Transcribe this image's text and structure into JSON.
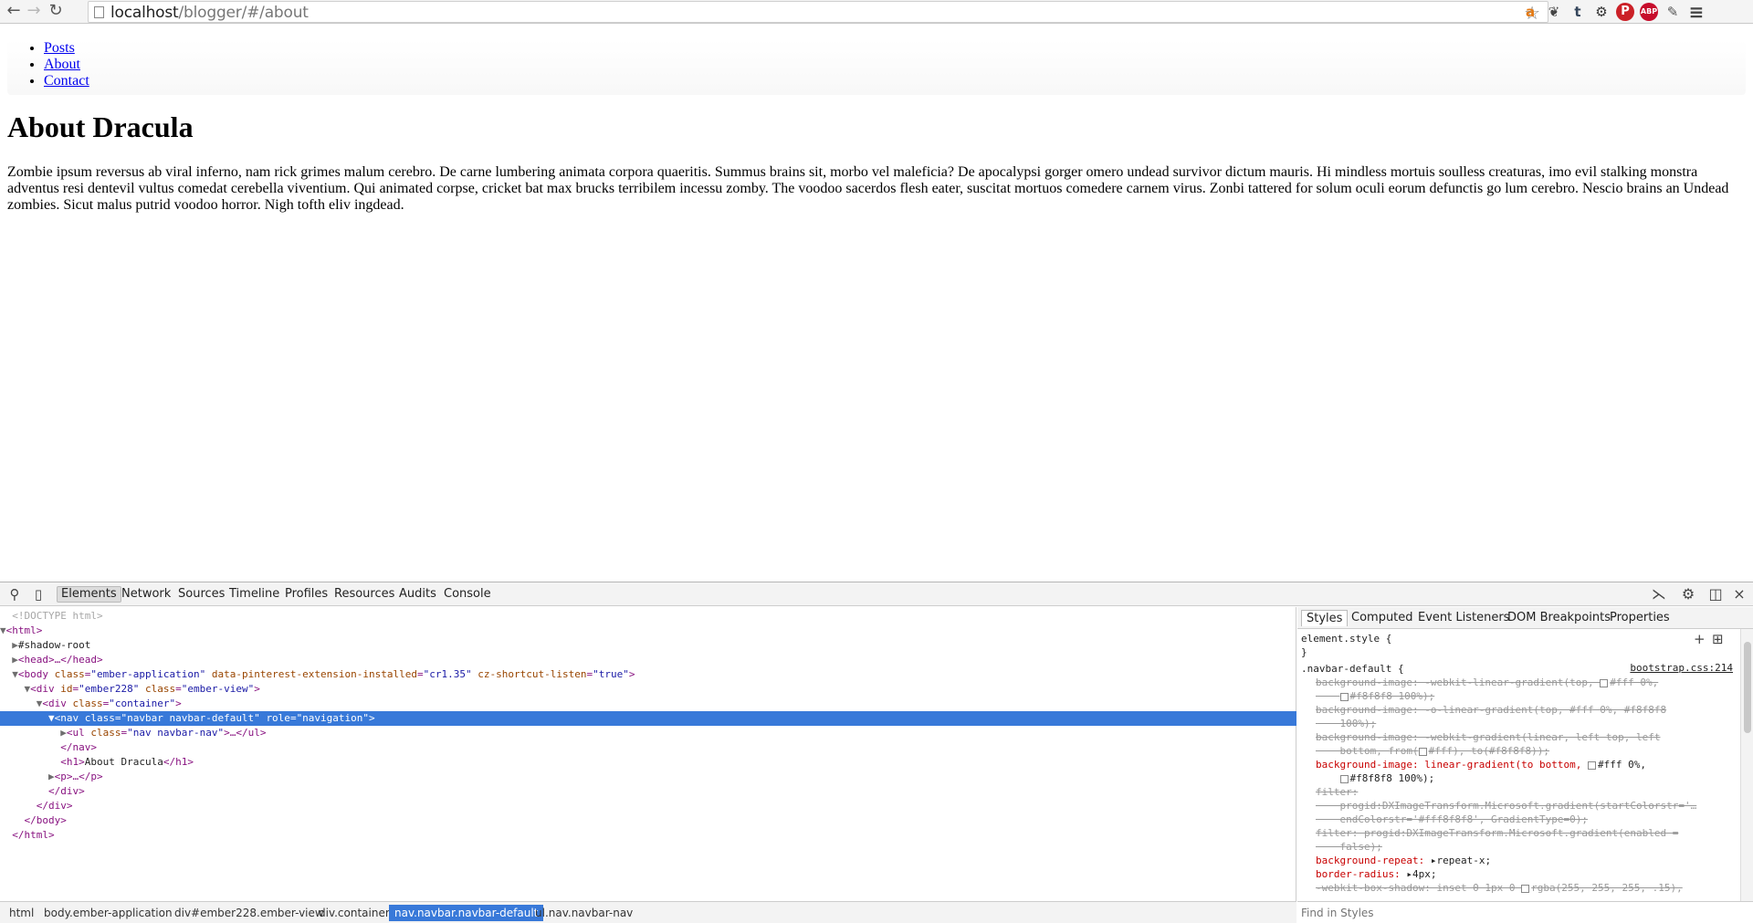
{
  "browser": {
    "back_icon": "←",
    "forward_icon": "→",
    "reload_icon": "↻",
    "url_host": "localhost",
    "url_path": "/blogger/#/about",
    "star_icon": "☆",
    "extensions": [
      {
        "name": "amazon",
        "glyph": "a",
        "color": "#e47911"
      },
      {
        "name": "evernote",
        "glyph": "❦",
        "color": "#444444"
      },
      {
        "name": "tumblr",
        "glyph": "t",
        "color": "#35465c"
      },
      {
        "name": "settings",
        "glyph": "⚙",
        "color": "#333333"
      },
      {
        "name": "pinterest",
        "glyph": "P",
        "color": "#cb2027"
      },
      {
        "name": "adblock-plus",
        "glyph": "ABP",
        "color": "#c70d2c"
      },
      {
        "name": "eyedropper",
        "glyph": "✎",
        "color": "#555555"
      },
      {
        "name": "menu",
        "glyph": "≡",
        "color": "#444444"
      }
    ]
  },
  "page": {
    "nav": [
      {
        "label": "Posts"
      },
      {
        "label": "About"
      },
      {
        "label": "Contact"
      }
    ],
    "title": "About Dracula",
    "paragraph": "Zombie ipsum reversus ab viral inferno, nam rick grimes malum cerebro. De carne lumbering animata corpora quaeritis. Summus brains sit, morbo vel maleficia? De apocalypsi gorger omero undead survivor dictum mauris. Hi mindless mortuis soulless creaturas, imo evil stalking monstra adventus resi dentevil vultus comedat cerebella viventium. Qui animated corpse, cricket bat max brucks terribilem incessu zomby. The voodoo sacerdos flesh eater, suscitat mortuos comedere carnem virus. Zonbi tattered for solum oculi eorum defunctis go lum cerebro. Nescio brains an Undead zombies. Sicut malus putrid voodoo horror. Nigh tofth eliv ingdead."
  },
  "devtools": {
    "tabs": [
      "Elements",
      "Network",
      "Sources",
      "Timeline",
      "Profiles",
      "Resources",
      "Audits",
      "Console"
    ],
    "active_tab": "Elements",
    "dom": {
      "doctype": "<!DOCTYPE html>",
      "html_open": "<html>",
      "shadow_root": "#shadow-root",
      "head": "<head>…</head>",
      "body_tag": "<body",
      "body_class_name": "class",
      "body_class_val": "\"ember-application\"",
      "body_pin_name": "data-pinterest-extension-installed",
      "body_pin_val": "\"cr1.35\"",
      "body_cz_name": "cz-shortcut-listen",
      "body_cz_val": "\"true\"",
      "div_ember_tag": "<div",
      "div_ember_id_name": "id",
      "div_ember_id_val": "\"ember228\"",
      "div_ember_class_name": "class",
      "div_ember_class_val": "\"ember-view\"",
      "div_container_tag": "<div",
      "div_container_class_name": "class",
      "div_container_class_val": "\"container\"",
      "nav_tag": "<nav",
      "nav_class_name": "class",
      "nav_class_val": "\"navbar navbar-default\"",
      "nav_role_name": "role",
      "nav_role_val": "\"navigation\"",
      "ul_tag": "<ul",
      "ul_class_name": "class",
      "ul_class_val": "\"nav navbar-nav\"",
      "ul_end": ">…</ul>",
      "nav_close": "</nav>",
      "h1_open": "<h1>",
      "h1_text": "About Dracula",
      "h1_close": "</h1>",
      "p": "<p>…</p>",
      "div_close": "</div>",
      "body_close": "</body>",
      "html_close": "</html>"
    },
    "breadcrumbs": [
      "html",
      "body.ember-application",
      "div#ember228.ember-view",
      "div.container",
      "nav.navbar.navbar-default",
      "ul.nav.navbar-nav"
    ],
    "active_breadcrumb": "nav.navbar.navbar-default",
    "side_tabs": [
      "Styles",
      "Computed",
      "Event Listeners",
      "DOM Breakpoints",
      "Properties"
    ],
    "active_side_tab": "Styles",
    "styles": {
      "element_style": "element.style {",
      "brace_close": "}",
      "rule_selector": ".navbar-default {",
      "rule_source": "bootstrap.css:214",
      "lines": [
        {
          "text": "background-image: -webkit-linear-gradient(top, ",
          "tail": "#fff 0%,",
          "struck": true
        },
        {
          "text": "    ",
          "tail": "#f8f8f8 100%);",
          "struck": true,
          "swatch_only": true
        },
        {
          "text": "background-image: -o-linear-gradient(top, #fff 0%, #f8f8f8",
          "struck": true
        },
        {
          "text": "    100%);",
          "struck": true
        },
        {
          "text": "background-image: -webkit-gradient(linear, left top, left",
          "struck": true
        },
        {
          "text": "    bottom, from(",
          "tail": "#fff), to(#f8f8f8));",
          "struck": true
        },
        {
          "text": "background-image: linear-gradient(to bottom, ",
          "tail": "#fff 0%,",
          "struck": false
        },
        {
          "text": "    ",
          "tail": "#f8f8f8 100%);",
          "struck": false,
          "swatch_only": true
        },
        {
          "text": "filter:",
          "struck": true
        },
        {
          "text": "    progid:DXImageTransform.Microsoft.gradient(startColorstr='…",
          "struck": true
        },
        {
          "text": "    endColorstr='#fff8f8f8', GradientType=0);",
          "struck": true
        },
        {
          "text": "filter: progid:DXImageTransform.Microsoft.gradient(enabled =",
          "struck": true
        },
        {
          "text": "    false);",
          "struck": true
        },
        {
          "text": "background-repeat: ",
          "tail": "repeat-x;",
          "struck": false,
          "arrow": true
        },
        {
          "text": "border-radius: ",
          "tail": "4px;",
          "struck": false,
          "arrow": true
        },
        {
          "text": "-webkit-box-shadow: inset 0 1px 0 ",
          "tail": "rgba(255, 255, 255, .15),",
          "struck": true
        }
      ],
      "find_placeholder": "Find in Styles"
    }
  }
}
